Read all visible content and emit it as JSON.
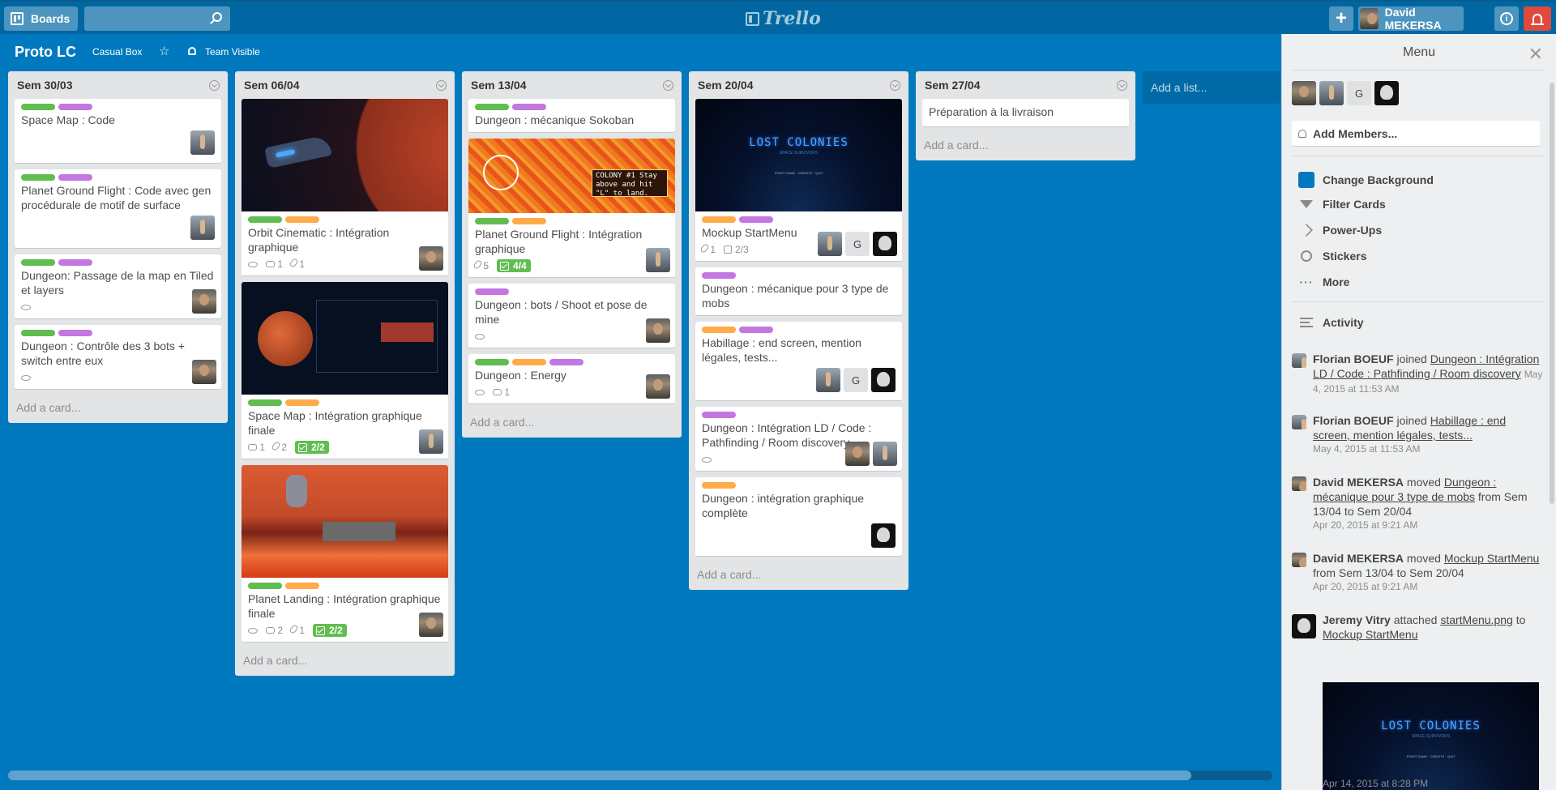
{
  "header": {
    "boards_label": "Boards",
    "search_value": "",
    "logo": "Trello",
    "add_label": "+",
    "user_name": "David MEKERSA",
    "info_label": "i"
  },
  "board": {
    "title": "Proto LC",
    "org": "Casual Box",
    "visibility": "Team Visible"
  },
  "lists": [
    {
      "name": "Sem 30/03",
      "add_card": "Add a card...",
      "cards": [
        {
          "title": "Space Map : Code"
        },
        {
          "title": "Planet Ground Flight : Code avec gen procédurale de motif de surface"
        },
        {
          "title": "Dungeon: Passage de la map en Tiled et layers"
        },
        {
          "title": "Dungeon : Contrôle des 3 bots + switch entre eux"
        }
      ]
    },
    {
      "name": "Sem 06/04",
      "add_card": "Add a card...",
      "cards": [
        {
          "title": "Orbit Cinematic : Intégration graphique",
          "comments": "1",
          "attachments": "1"
        },
        {
          "title": "Space Map : Intégration graphique finale",
          "comments": "1",
          "attachments": "2",
          "checklist": "2/2"
        },
        {
          "title": "Planet Landing : Intégration graphique finale",
          "comments": "2",
          "attachments": "1",
          "checklist": "2/2"
        }
      ]
    },
    {
      "name": "Sem 13/04",
      "add_card": "Add a card...",
      "cards": [
        {
          "title": "Dungeon : mécanique Sokoban"
        },
        {
          "title": "Planet Ground Flight : Intégration graphique",
          "attachments": "5",
          "checklist": "4/4",
          "image_text": "COLONY #1 Stay above and hit \"L\" to land."
        },
        {
          "title": "Dungeon : bots / Shoot et pose de mine"
        },
        {
          "title": "Dungeon : Energy",
          "comments": "1"
        }
      ]
    },
    {
      "name": "Sem 20/04",
      "add_card": "Add a card...",
      "cards": [
        {
          "title": "Mockup StartMenu",
          "attachments": "1",
          "checklist": "2/3",
          "image_title": "LOST COLONIES",
          "image_sub": "SPACE SURVIVORS",
          "image_menu": "START GAME · CREDITS · QUIT"
        },
        {
          "title": "Dungeon : mécanique pour 3 type de mobs"
        },
        {
          "title": "Habillage : end screen, mention légales, tests..."
        },
        {
          "title": "Dungeon : Intégration LD / Code : Pathfinding / Room discovery"
        },
        {
          "title": "Dungeon : intégration graphique complète"
        }
      ]
    },
    {
      "name": "Sem 27/04",
      "add_card": "Add a card...",
      "cards": [
        {
          "title": "Préparation à la livraison"
        }
      ]
    }
  ],
  "add_list": "Add a list...",
  "member_initial": "G",
  "sidebar": {
    "title": "Menu",
    "add_members": "Add Members...",
    "items": [
      "Change Background",
      "Filter Cards",
      "Power-Ups",
      "Stickers",
      "More"
    ],
    "activity_title": "Activity",
    "activities": [
      {
        "who": "Florian BOEUF",
        "verb": "joined",
        "target": "Dungeon : Intégration LD / Code : Pathfinding / Room discovery",
        "date": "May 4, 2015 at 11:53 AM"
      },
      {
        "who": "Florian BOEUF",
        "verb": "joined",
        "target": "Habillage : end screen, mention légales, tests...",
        "date": "May 4, 2015 at 11:53 AM"
      },
      {
        "who": "David MEKERSA",
        "verb": "moved",
        "target": "Dungeon : mécanique pour 3 type de mobs",
        "extra": "from Sem 13/04 to Sem 20/04",
        "date": "Apr 20, 2015 at 9:21 AM"
      },
      {
        "who": "David MEKERSA",
        "verb": "moved",
        "target": "Mockup StartMenu",
        "extra": "from Sem 13/04 to Sem 20/04",
        "date": "Apr 20, 2015 at 9:21 AM"
      },
      {
        "who": "Jeremy Vitry",
        "verb": "attached",
        "target": "startMenu.png",
        "extra_word": "to",
        "target2": "Mockup StartMenu",
        "date": "Apr 14, 2015 at 8:28 PM"
      }
    ]
  },
  "colors": {
    "board_bg": "#0079bf",
    "label_green": "#61bd4f",
    "label_purple": "#c377e0",
    "label_orange": "#ffab4a",
    "notification": "#e04a3c"
  },
  "icons": [
    "boards-icon",
    "search-icon",
    "trello-logo",
    "plus-icon",
    "info-icon",
    "bell-icon",
    "star-icon",
    "team-icon",
    "eye-icon",
    "comment-icon",
    "attachment-icon",
    "checklist-icon",
    "close-icon",
    "filter-icon",
    "power-ups-icon",
    "sticker-icon",
    "more-icon",
    "activity-icon",
    "person-icon"
  ]
}
